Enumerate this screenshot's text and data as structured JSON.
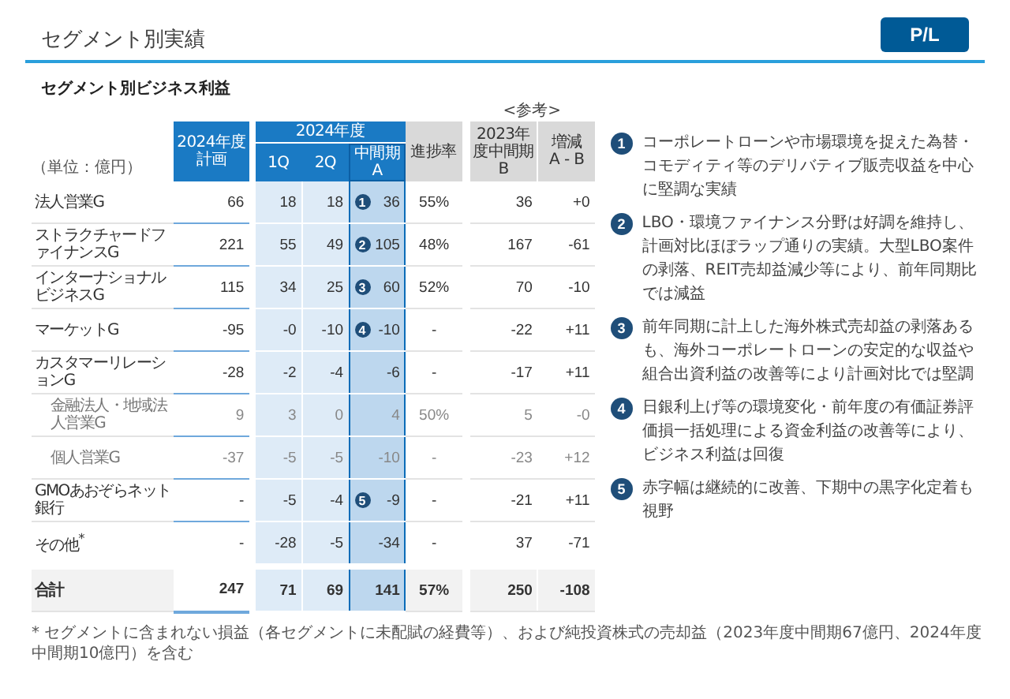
{
  "header": {
    "title": "セグメント別実績",
    "badge": "P/L"
  },
  "section_title": "セグメント別ビジネス利益",
  "table": {
    "unit": "（単位：億円）",
    "reference_note": "<参考>",
    "plan_header": "2024年度計画",
    "group_header": "2024年度",
    "group_columns": [
      "1Q",
      "2Q",
      "中間期\nA"
    ],
    "progress_header": "進捗率",
    "reference_columns": [
      "2023年度中間期B",
      "増減\nA - B"
    ],
    "rows": [
      {
        "kind": "main",
        "label": "法人営業G",
        "marker": "1",
        "cells": [
          "66",
          "18",
          "18",
          "36",
          "55%",
          "36",
          "+0"
        ]
      },
      {
        "kind": "main",
        "label": "ストラクチャードファイナンスG",
        "marker": "2",
        "cells": [
          "221",
          "55",
          "49",
          "105",
          "48%",
          "167",
          "-61"
        ]
      },
      {
        "kind": "main",
        "label": "インターナショナルビジネスG",
        "marker": "3",
        "cells": [
          "115",
          "34",
          "25",
          "60",
          "52%",
          "70",
          "-10"
        ]
      },
      {
        "kind": "main",
        "label": "マーケットG",
        "marker": "4",
        "cells": [
          "-95",
          "-0",
          "-10",
          "-10",
          "-",
          "-22",
          "+11"
        ]
      },
      {
        "kind": "main",
        "label": "カスタマーリレーションG",
        "cells": [
          "-28",
          "-2",
          "-4",
          "-6",
          "-",
          "-17",
          "+11"
        ]
      },
      {
        "kind": "sub",
        "label": "金融法人・地域法人営業G",
        "cells": [
          "9",
          "3",
          "0",
          "4",
          "50%",
          "5",
          "-0"
        ]
      },
      {
        "kind": "sub",
        "label": "個人営業G",
        "cells": [
          "-37",
          "-5",
          "-5",
          "-10",
          "-",
          "-23",
          "+12"
        ]
      },
      {
        "kind": "main",
        "label": "GMOあおぞらネット銀行",
        "marker": "5",
        "cells": [
          "-",
          "-5",
          "-4",
          "-9",
          "-",
          "-21",
          "+11"
        ]
      },
      {
        "kind": "main",
        "label": "その他$^{*}$",
        "cells": [
          "-",
          "-28",
          "-5",
          "-34",
          "-",
          "37",
          "-71"
        ]
      },
      {
        "kind": "total",
        "label": "合計",
        "cells": [
          "247",
          "71",
          "69",
          "141",
          "57%",
          "250",
          "-108"
        ]
      }
    ]
  },
  "notes": [
    {
      "marker": "1",
      "text": "コーポレートローンや市場環境を捉えた為替・コモディティ等のデリバティブ販売収益を中心に堅調な実績"
    },
    {
      "marker": "2",
      "text": "LBO・環境ファイナンス分野は好調を維持し、計画対比ほぼラップ通りの実績。大型LBO案件の剥落、REIT売却益減少等により、前年同期比では減益"
    },
    {
      "marker": "3",
      "text": "前年同期に計上した海外株式売却益の剥落あるも、海外コーポレートローンの安定的な収益や組合出資利益の改善等により計画対比では堅調"
    },
    {
      "marker": "4",
      "text": "日銀利上げ等の環境変化・前年度の有価証券評価損一括処理による資金利益の改善等により、ビジネス利益は回復"
    },
    {
      "marker": "5",
      "text": "赤字幅は継続的に改善、下期中の黒字化定着も視野"
    }
  ],
  "footnote": "* セグメントに含まれない損益（各セグメントに未配賦の経費等）、および純投資株式の売却益（2023年度中間期67億円、2024年度中間期10億円）を含む"
}
